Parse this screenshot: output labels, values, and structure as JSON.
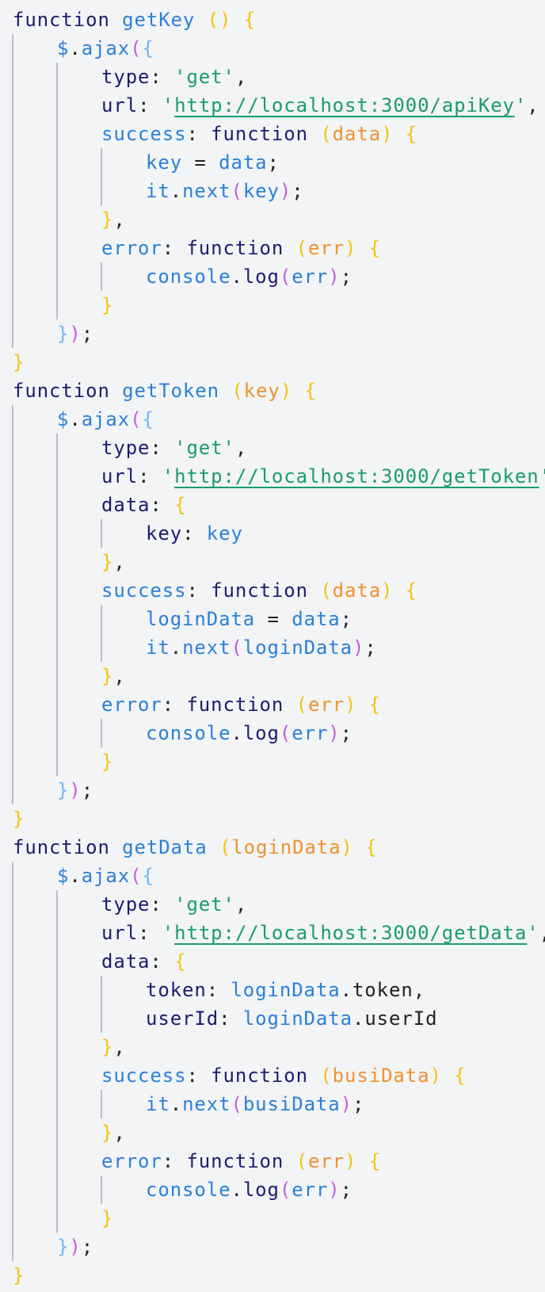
{
  "editor": {
    "lines": [
      {
        "indent": 0,
        "tokens": [
          [
            "kw",
            "function"
          ],
          [
            "pn",
            " "
          ],
          [
            "fn",
            "getKey"
          ],
          [
            "pn",
            " "
          ],
          [
            "p1",
            "("
          ],
          [
            "p1",
            ")"
          ],
          [
            "pn",
            " "
          ],
          [
            "p1",
            "{"
          ]
        ]
      },
      {
        "indent": 1,
        "tokens": [
          [
            "fn",
            "$"
          ],
          [
            "pn",
            "."
          ],
          [
            "fn",
            "ajax"
          ],
          [
            "p2",
            "("
          ],
          [
            "p3",
            "{"
          ]
        ]
      },
      {
        "indent": 2,
        "tokens": [
          [
            "pr",
            "type"
          ],
          [
            "pn",
            ": "
          ],
          [
            "str",
            "'get'"
          ],
          [
            "pn",
            ","
          ]
        ]
      },
      {
        "indent": 2,
        "tokens": [
          [
            "pr",
            "url"
          ],
          [
            "pn",
            ": "
          ],
          [
            "str",
            "'"
          ],
          [
            "url",
            "http://localhost:3000/apiKey"
          ],
          [
            "str",
            "'"
          ],
          [
            "pn",
            ","
          ]
        ]
      },
      {
        "indent": 2,
        "tokens": [
          [
            "fn",
            "success"
          ],
          [
            "pn",
            ": "
          ],
          [
            "kw",
            "function"
          ],
          [
            "pn",
            " "
          ],
          [
            "p1",
            "("
          ],
          [
            "pm",
            "data"
          ],
          [
            "p1",
            ")"
          ],
          [
            "pn",
            " "
          ],
          [
            "p1",
            "{"
          ]
        ]
      },
      {
        "indent": 3,
        "tokens": [
          [
            "id",
            "key"
          ],
          [
            "pn",
            " = "
          ],
          [
            "id",
            "data"
          ],
          [
            "pn",
            ";"
          ]
        ]
      },
      {
        "indent": 3,
        "tokens": [
          [
            "id",
            "it"
          ],
          [
            "pn",
            "."
          ],
          [
            "fn",
            "next"
          ],
          [
            "p2",
            "("
          ],
          [
            "id",
            "key"
          ],
          [
            "p2",
            ")"
          ],
          [
            "pn",
            ";"
          ]
        ]
      },
      {
        "indent": 2,
        "tokens": [
          [
            "p1",
            "}"
          ],
          [
            "pn",
            ","
          ]
        ]
      },
      {
        "indent": 2,
        "tokens": [
          [
            "fn",
            "error"
          ],
          [
            "pn",
            ": "
          ],
          [
            "kw",
            "function"
          ],
          [
            "pn",
            " "
          ],
          [
            "p1",
            "("
          ],
          [
            "pm",
            "err"
          ],
          [
            "p1",
            ")"
          ],
          [
            "pn",
            " "
          ],
          [
            "p1",
            "{"
          ]
        ]
      },
      {
        "indent": 3,
        "tokens": [
          [
            "id",
            "console"
          ],
          [
            "pn",
            "."
          ],
          [
            "kw",
            "log"
          ],
          [
            "p2",
            "("
          ],
          [
            "id",
            "err"
          ],
          [
            "p2",
            ")"
          ],
          [
            "pn",
            ";"
          ]
        ]
      },
      {
        "indent": 2,
        "tokens": [
          [
            "p1",
            "}"
          ]
        ]
      },
      {
        "indent": 1,
        "tokens": [
          [
            "p3",
            "}"
          ],
          [
            "p2",
            ")"
          ],
          [
            "pn",
            ";"
          ]
        ]
      },
      {
        "indent": 0,
        "tokens": [
          [
            "p1",
            "}"
          ]
        ]
      },
      {
        "indent": 0,
        "tokens": [
          [
            "kw",
            "function"
          ],
          [
            "pn",
            " "
          ],
          [
            "fn",
            "getToken"
          ],
          [
            "pn",
            " "
          ],
          [
            "p1",
            "("
          ],
          [
            "pm",
            "key"
          ],
          [
            "p1",
            ")"
          ],
          [
            "pn",
            " "
          ],
          [
            "p1",
            "{"
          ]
        ]
      },
      {
        "indent": 1,
        "tokens": [
          [
            "fn",
            "$"
          ],
          [
            "pn",
            "."
          ],
          [
            "fn",
            "ajax"
          ],
          [
            "p2",
            "("
          ],
          [
            "p3",
            "{"
          ]
        ]
      },
      {
        "indent": 2,
        "tokens": [
          [
            "pr",
            "type"
          ],
          [
            "pn",
            ": "
          ],
          [
            "str",
            "'get'"
          ],
          [
            "pn",
            ","
          ]
        ]
      },
      {
        "indent": 2,
        "tokens": [
          [
            "pr",
            "url"
          ],
          [
            "pn",
            ": "
          ],
          [
            "str",
            "'"
          ],
          [
            "url",
            "http://localhost:3000/getToken"
          ],
          [
            "str",
            "'"
          ],
          [
            "pn",
            ","
          ]
        ]
      },
      {
        "indent": 2,
        "tokens": [
          [
            "pr",
            "data"
          ],
          [
            "pn",
            ": "
          ],
          [
            "p1",
            "{"
          ]
        ]
      },
      {
        "indent": 3,
        "tokens": [
          [
            "pr",
            "key"
          ],
          [
            "pn",
            ": "
          ],
          [
            "id",
            "key"
          ]
        ]
      },
      {
        "indent": 2,
        "tokens": [
          [
            "p1",
            "}"
          ],
          [
            "pn",
            ","
          ]
        ]
      },
      {
        "indent": 2,
        "tokens": [
          [
            "fn",
            "success"
          ],
          [
            "pn",
            ": "
          ],
          [
            "kw",
            "function"
          ],
          [
            "pn",
            " "
          ],
          [
            "p1",
            "("
          ],
          [
            "pm",
            "data"
          ],
          [
            "p1",
            ")"
          ],
          [
            "pn",
            " "
          ],
          [
            "p1",
            "{"
          ]
        ]
      },
      {
        "indent": 3,
        "tokens": [
          [
            "id",
            "loginData"
          ],
          [
            "pn",
            " = "
          ],
          [
            "id",
            "data"
          ],
          [
            "pn",
            ";"
          ]
        ]
      },
      {
        "indent": 3,
        "tokens": [
          [
            "id",
            "it"
          ],
          [
            "pn",
            "."
          ],
          [
            "fn",
            "next"
          ],
          [
            "p2",
            "("
          ],
          [
            "id",
            "loginData"
          ],
          [
            "p2",
            ")"
          ],
          [
            "pn",
            ";"
          ]
        ]
      },
      {
        "indent": 2,
        "tokens": [
          [
            "p1",
            "}"
          ],
          [
            "pn",
            ","
          ]
        ]
      },
      {
        "indent": 2,
        "tokens": [
          [
            "fn",
            "error"
          ],
          [
            "pn",
            ": "
          ],
          [
            "kw",
            "function"
          ],
          [
            "pn",
            " "
          ],
          [
            "p1",
            "("
          ],
          [
            "pm",
            "err"
          ],
          [
            "p1",
            ")"
          ],
          [
            "pn",
            " "
          ],
          [
            "p1",
            "{"
          ]
        ]
      },
      {
        "indent": 3,
        "tokens": [
          [
            "id",
            "console"
          ],
          [
            "pn",
            "."
          ],
          [
            "kw",
            "log"
          ],
          [
            "p2",
            "("
          ],
          [
            "id",
            "err"
          ],
          [
            "p2",
            ")"
          ],
          [
            "pn",
            ";"
          ]
        ]
      },
      {
        "indent": 2,
        "tokens": [
          [
            "p1",
            "}"
          ]
        ]
      },
      {
        "indent": 1,
        "tokens": [
          [
            "p3",
            "}"
          ],
          [
            "p2",
            ")"
          ],
          [
            "pn",
            ";"
          ]
        ]
      },
      {
        "indent": 0,
        "tokens": [
          [
            "p1",
            "}"
          ]
        ]
      },
      {
        "indent": 0,
        "tokens": [
          [
            "kw",
            "function"
          ],
          [
            "pn",
            " "
          ],
          [
            "fn",
            "getData"
          ],
          [
            "pn",
            " "
          ],
          [
            "p1",
            "("
          ],
          [
            "pm",
            "loginData"
          ],
          [
            "p1",
            ")"
          ],
          [
            "pn",
            " "
          ],
          [
            "p1",
            "{"
          ]
        ]
      },
      {
        "indent": 1,
        "tokens": [
          [
            "fn",
            "$"
          ],
          [
            "pn",
            "."
          ],
          [
            "fn",
            "ajax"
          ],
          [
            "p2",
            "("
          ],
          [
            "p3",
            "{"
          ]
        ]
      },
      {
        "indent": 2,
        "tokens": [
          [
            "pr",
            "type"
          ],
          [
            "pn",
            ": "
          ],
          [
            "str",
            "'get'"
          ],
          [
            "pn",
            ","
          ]
        ]
      },
      {
        "indent": 2,
        "tokens": [
          [
            "pr",
            "url"
          ],
          [
            "pn",
            ": "
          ],
          [
            "str",
            "'"
          ],
          [
            "url",
            "http://localhost:3000/getData"
          ],
          [
            "str",
            "'"
          ],
          [
            "pn",
            ","
          ]
        ]
      },
      {
        "indent": 2,
        "tokens": [
          [
            "pr",
            "data"
          ],
          [
            "pn",
            ": "
          ],
          [
            "p1",
            "{"
          ]
        ]
      },
      {
        "indent": 3,
        "tokens": [
          [
            "pr",
            "token"
          ],
          [
            "pn",
            ": "
          ],
          [
            "id",
            "loginData"
          ],
          [
            "pn",
            ".token,"
          ]
        ]
      },
      {
        "indent": 3,
        "tokens": [
          [
            "pr",
            "userId"
          ],
          [
            "pn",
            ": "
          ],
          [
            "id",
            "loginData"
          ],
          [
            "pn",
            ".userId"
          ]
        ]
      },
      {
        "indent": 2,
        "tokens": [
          [
            "p1",
            "}"
          ],
          [
            "pn",
            ","
          ]
        ]
      },
      {
        "indent": 2,
        "tokens": [
          [
            "fn",
            "success"
          ],
          [
            "pn",
            ": "
          ],
          [
            "kw",
            "function"
          ],
          [
            "pn",
            " "
          ],
          [
            "p1",
            "("
          ],
          [
            "pm",
            "busiData"
          ],
          [
            "p1",
            ")"
          ],
          [
            "pn",
            " "
          ],
          [
            "p1",
            "{"
          ]
        ]
      },
      {
        "indent": 3,
        "tokens": [
          [
            "id",
            "it"
          ],
          [
            "pn",
            "."
          ],
          [
            "fn",
            "next"
          ],
          [
            "p2",
            "("
          ],
          [
            "id",
            "busiData"
          ],
          [
            "p2",
            ")"
          ],
          [
            "pn",
            ";"
          ]
        ]
      },
      {
        "indent": 2,
        "tokens": [
          [
            "p1",
            "}"
          ],
          [
            "pn",
            ","
          ]
        ]
      },
      {
        "indent": 2,
        "tokens": [
          [
            "fn",
            "error"
          ],
          [
            "pn",
            ": "
          ],
          [
            "kw",
            "function"
          ],
          [
            "pn",
            " "
          ],
          [
            "p1",
            "("
          ],
          [
            "pm",
            "err"
          ],
          [
            "p1",
            ")"
          ],
          [
            "pn",
            " "
          ],
          [
            "p1",
            "{"
          ]
        ]
      },
      {
        "indent": 3,
        "tokens": [
          [
            "id",
            "console"
          ],
          [
            "pn",
            "."
          ],
          [
            "kw",
            "log"
          ],
          [
            "p2",
            "("
          ],
          [
            "id",
            "err"
          ],
          [
            "p2",
            ")"
          ],
          [
            "pn",
            ";"
          ]
        ]
      },
      {
        "indent": 2,
        "tokens": [
          [
            "p1",
            "}"
          ]
        ]
      },
      {
        "indent": 1,
        "tokens": [
          [
            "p3",
            "}"
          ],
          [
            "p2",
            ")"
          ],
          [
            "pn",
            ";"
          ]
        ]
      },
      {
        "indent": 0,
        "tokens": [
          [
            "p1",
            "}"
          ]
        ]
      }
    ]
  }
}
